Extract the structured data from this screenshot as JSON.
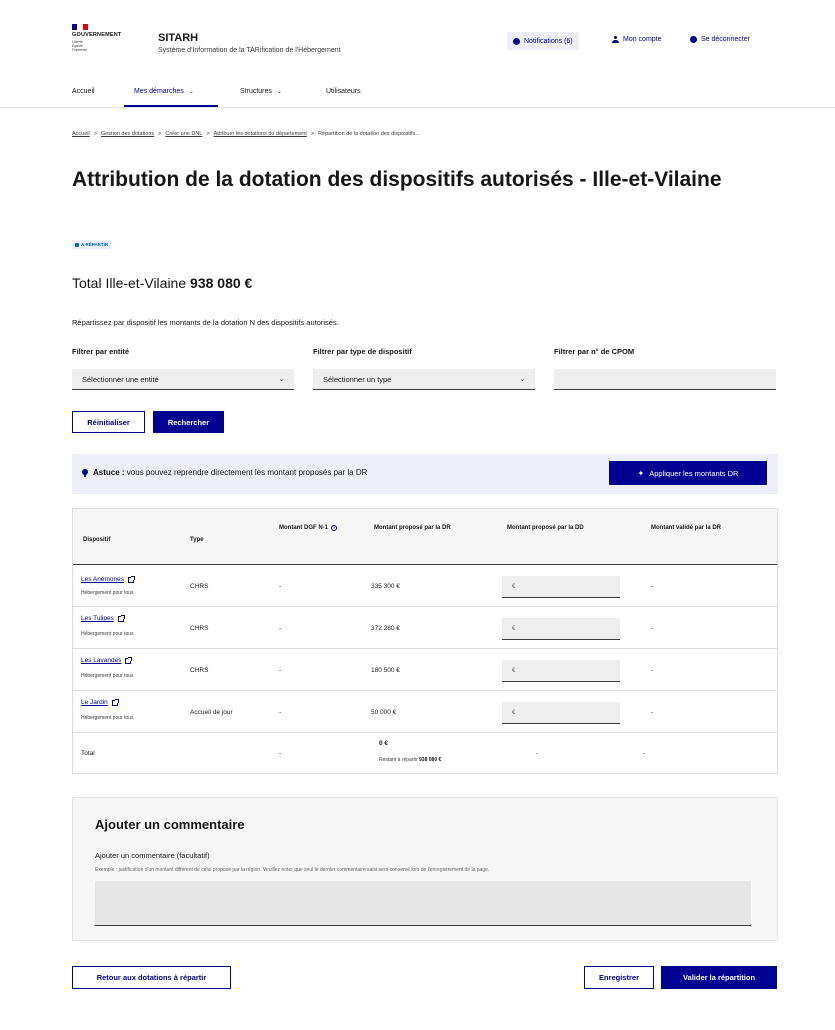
{
  "header": {
    "logo_text": "GOUVERNEMENT",
    "logo_motto": [
      "Liberté",
      "Égalité",
      "Fraternité"
    ],
    "app_name": "SITARH",
    "app_subtitle": "Système d'Information de la TARification de l'Hébergement",
    "notifications": "Notifications (6)",
    "account": "Mon compte",
    "logout": "Se déconnecter"
  },
  "nav": {
    "home": "Accueil",
    "demarches": "Mes démarches",
    "structures": "Structures",
    "users": "Utilisateurs"
  },
  "breadcrumb": {
    "items": [
      "Accueil",
      "Gestion des dotations",
      "Créer une DNL",
      "Attribuer les dotations du département"
    ],
    "current": "Répartition de la dotation des dispositifs..."
  },
  "page": {
    "title": "Attribution de la dotation des dispositifs autorisés - Ille-et-Vilaine",
    "badge": "À RÉPARTIR",
    "total_label": "Total Ille-et-Vilaine",
    "total_value": "938 080 €",
    "intro": "Répartissez par dispositif les montants de la dotation N des dispositifs autorisés."
  },
  "filters": {
    "entity_label": "Filtrer par entité",
    "entity_placeholder": "Sélectionner une entité",
    "type_label": "Filtrer par type de dispositif",
    "type_placeholder": "Sélectionner un type",
    "cpom_label": "Filtrer par n° de CPOM",
    "reset": "Réinitialiser",
    "search": "Rechercher"
  },
  "tip": {
    "bold": "Astuce :",
    "text": "vous pouvez reprendre directement les montant proposés par la DR",
    "button": "Appliquer les montants DR"
  },
  "table": {
    "headers": {
      "dispositif": "Dispositif",
      "type": "Type",
      "dgf": "Montant DGF N-1",
      "dr": "Montant proposé par la DR",
      "dd": "Montant proposé par la DD",
      "validated": "Montant validé par la DR"
    },
    "rows": [
      {
        "name": "Les Anémones",
        "sub": "Hébergement pour tous",
        "type": "CHRS",
        "dgf": "-",
        "dr": "335 300 €",
        "dd": "€",
        "validated": "-"
      },
      {
        "name": "Les Tulipes",
        "sub": "Hébergement pour tous",
        "type": "CHRS",
        "dgf": "-",
        "dr": "372 280 €",
        "dd": "€",
        "validated": "-"
      },
      {
        "name": "Les Lavandes",
        "sub": "Hébergement pour tous",
        "type": "CHRS",
        "dgf": "-",
        "dr": "180 500 €",
        "dd": "€",
        "validated": "-"
      },
      {
        "name": "Le Jardin",
        "sub": "Hébergement pour tous",
        "type": "Accueil de jour",
        "dgf": "-",
        "dr": "50 000 €",
        "dd": "€",
        "validated": "-"
      }
    ],
    "total": {
      "label": "Total",
      "dgf": "-",
      "dr": "0 €",
      "remaining_label": "Restant à répartir",
      "remaining_value": "938 080 €",
      "dd": "-",
      "validated": "-"
    }
  },
  "comment": {
    "title": "Ajouter un commentaire",
    "label": "Ajouter un commentaire (facultatif)",
    "hint": "Exemple : justification d'un montant différent de celui proposé par la région. Veuillez noter que seul le dernier commentaire saisi sera conservé lors de l'enregistrement de la page."
  },
  "actions": {
    "back": "Retour aux dotations à répartir",
    "save": "Enregistrer",
    "validate": "Valider la répartition"
  },
  "colors": {
    "primary": "#000091",
    "flag_blue": "#000091",
    "flag_red": "#e1000f",
    "tip_bg": "#eeeef8"
  }
}
